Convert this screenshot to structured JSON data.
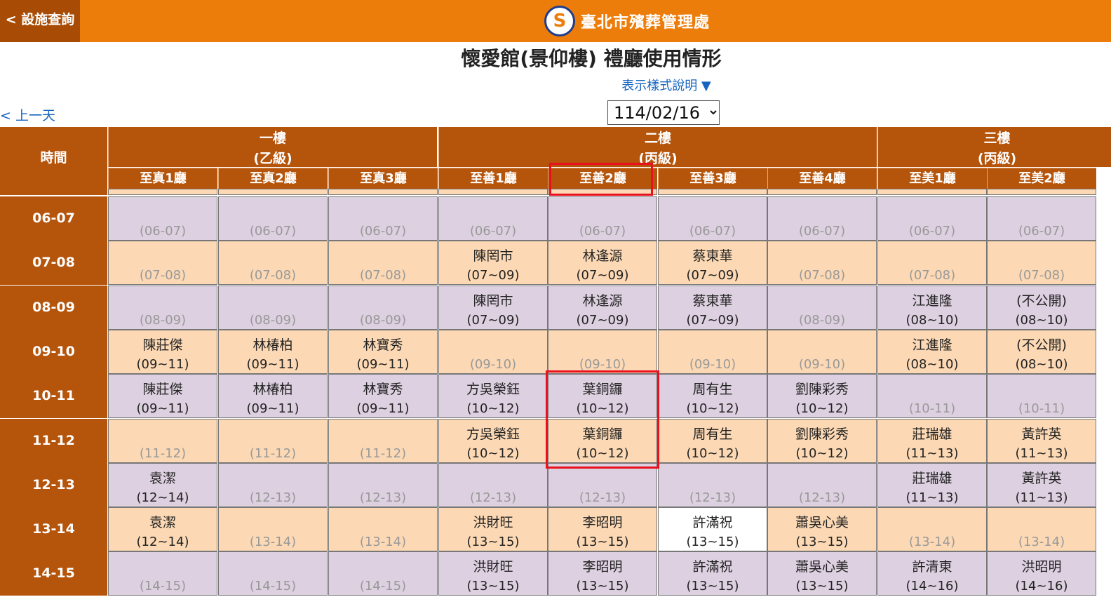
{
  "header": {
    "back_label": "< 設施查詢",
    "site_title": "臺北市殯葬管理處",
    "logo_glyph": "S"
  },
  "page": {
    "title": "懷愛館(景仰樓) 禮廳使用情形",
    "legend_link": "表示樣式說明 ▼",
    "prev_day": "< 上一天",
    "date": "114/02/16"
  },
  "table": {
    "time_header": "時間",
    "floors": [
      {
        "name": "一樓",
        "grade": "(乙級)"
      },
      {
        "name": "二樓",
        "grade": "(丙級)"
      },
      {
        "name": "三樓",
        "grade": "(丙級)"
      }
    ],
    "halls": [
      "至真1廳",
      "至真2廳",
      "至真3廳",
      "至善1廳",
      "至善2廳",
      "至善3廳",
      "至善4廳",
      "至美1廳",
      "至美2廳"
    ],
    "rows": [
      {
        "time": "06-07",
        "cells": [
          {
            "e": "(06-07)"
          },
          {
            "e": "(06-07)"
          },
          {
            "e": "(06-07)"
          },
          {
            "e": "(06-07)"
          },
          {
            "e": "(06-07)"
          },
          {
            "e": "(06-07)"
          },
          {
            "e": "(06-07)"
          },
          {
            "e": "(06-07)"
          },
          {
            "e": "(06-07)"
          }
        ]
      },
      {
        "time": "07-08",
        "cells": [
          {
            "e": "(07-08)"
          },
          {
            "e": "(07-08)"
          },
          {
            "e": "(07-08)"
          },
          {
            "n": "陳罔市",
            "t": "(07~09)"
          },
          {
            "n": "林逢源",
            "t": "(07~09)"
          },
          {
            "n": "蔡東華",
            "t": "(07~09)"
          },
          {
            "e": "(07-08)"
          },
          {
            "e": "(07-08)"
          },
          {
            "e": "(07-08)"
          }
        ]
      },
      {
        "time": "08-09",
        "cells": [
          {
            "e": "(08-09)"
          },
          {
            "e": "(08-09)"
          },
          {
            "e": "(08-09)"
          },
          {
            "n": "陳罔市",
            "t": "(07~09)"
          },
          {
            "n": "林逢源",
            "t": "(07~09)"
          },
          {
            "n": "蔡東華",
            "t": "(07~09)"
          },
          {
            "e": "(08-09)"
          },
          {
            "n": "江進隆",
            "t": "(08~10)"
          },
          {
            "n": "(不公開)",
            "t": "(08~10)"
          }
        ]
      },
      {
        "time": "09-10",
        "cells": [
          {
            "n": "陳莊傑",
            "t": "(09~11)"
          },
          {
            "n": "林椿柏",
            "t": "(09~11)"
          },
          {
            "n": "林寶秀",
            "t": "(09~11)"
          },
          {
            "e": "(09-10)"
          },
          {
            "e": "(09-10)"
          },
          {
            "e": "(09-10)"
          },
          {
            "e": "(09-10)"
          },
          {
            "n": "江進隆",
            "t": "(08~10)"
          },
          {
            "n": "(不公開)",
            "t": "(08~10)"
          }
        ]
      },
      {
        "time": "10-11",
        "cells": [
          {
            "n": "陳莊傑",
            "t": "(09~11)"
          },
          {
            "n": "林椿柏",
            "t": "(09~11)"
          },
          {
            "n": "林寶秀",
            "t": "(09~11)"
          },
          {
            "n": "方吳榮鈺",
            "t": "(10~12)"
          },
          {
            "n": "葉銅鑼",
            "t": "(10~12)"
          },
          {
            "n": "周有生",
            "t": "(10~12)"
          },
          {
            "n": "劉陳彩秀",
            "t": "(10~12)"
          },
          {
            "e": "(10-11)"
          },
          {
            "e": "(10-11)"
          }
        ]
      },
      {
        "time": "11-12",
        "cells": [
          {
            "e": "(11-12)"
          },
          {
            "e": "(11-12)"
          },
          {
            "e": "(11-12)"
          },
          {
            "n": "方吳榮鈺",
            "t": "(10~12)"
          },
          {
            "n": "葉銅鑼",
            "t": "(10~12)"
          },
          {
            "n": "周有生",
            "t": "(10~12)"
          },
          {
            "n": "劉陳彩秀",
            "t": "(10~12)"
          },
          {
            "n": "莊瑞雄",
            "t": "(11~13)"
          },
          {
            "n": "黃許英",
            "t": "(11~13)"
          }
        ]
      },
      {
        "time": "12-13",
        "cells": [
          {
            "n": "袁潔",
            "t": "(12~14)"
          },
          {
            "e": "(12-13)"
          },
          {
            "e": "(12-13)"
          },
          {
            "e": "(12-13)"
          },
          {
            "e": "(12-13)"
          },
          {
            "e": "(12-13)"
          },
          {
            "e": "(12-13)"
          },
          {
            "n": "莊瑞雄",
            "t": "(11~13)"
          },
          {
            "n": "黃許英",
            "t": "(11~13)"
          }
        ]
      },
      {
        "time": "13-14",
        "cells": [
          {
            "n": "袁潔",
            "t": "(12~14)"
          },
          {
            "e": "(13-14)"
          },
          {
            "e": "(13-14)"
          },
          {
            "n": "洪財旺",
            "t": "(13~15)"
          },
          {
            "n": "李昭明",
            "t": "(13~15)"
          },
          {
            "n": "許滿祝",
            "t": "(13~15)",
            "w": true
          },
          {
            "n": "蕭吳心美",
            "t": "(13~15)"
          },
          {
            "e": "(13-14)"
          },
          {
            "e": "(13-14)"
          }
        ]
      },
      {
        "time": "14-15",
        "cells": [
          {
            "e": "(14-15)"
          },
          {
            "e": "(14-15)"
          },
          {
            "e": "(14-15)"
          },
          {
            "n": "洪財旺",
            "t": "(13~15)"
          },
          {
            "n": "李昭明",
            "t": "(13~15)"
          },
          {
            "n": "許滿祝",
            "t": "(13~15)"
          },
          {
            "n": "蕭吳心美",
            "t": "(13~15)"
          },
          {
            "n": "許清東",
            "t": "(14~16)"
          },
          {
            "n": "洪昭明",
            "t": "(14~16)"
          }
        ]
      }
    ]
  },
  "colors": {
    "header_bg": "#ed7d0a",
    "table_header_bg": "#b5540b",
    "odd_row": "#ddd0e1",
    "even_row": "#fcd9b4",
    "highlight": "#e8111d",
    "link": "#1565c0"
  }
}
